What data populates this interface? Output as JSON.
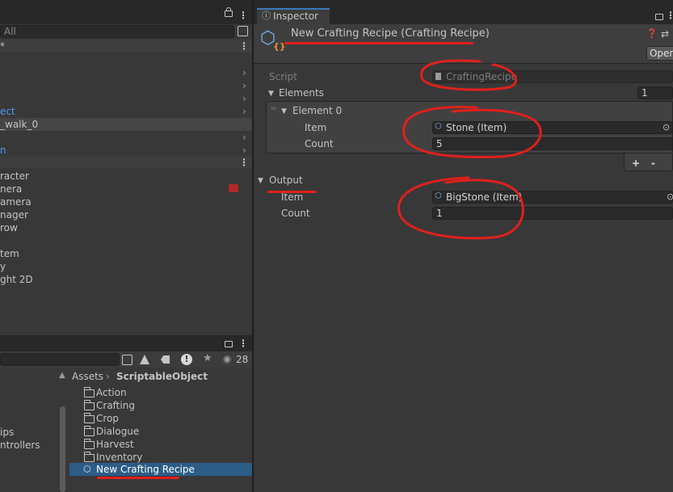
{
  "hierarchy": {
    "search_placeholder": "All",
    "scene_marker": "*",
    "items": [
      "ect",
      "_walk_0",
      "n"
    ],
    "items2": [
      "racter",
      "nera",
      "amera",
      "nager",
      "row",
      "tem",
      "y",
      "ght 2D"
    ]
  },
  "project": {
    "count": "28",
    "left_items": [
      "ips",
      "ntrollers"
    ],
    "breadcrumb": [
      "Assets",
      "ScriptableObject"
    ],
    "folders": [
      "Action",
      "Crafting",
      "Crop",
      "Dialogue",
      "Harvest",
      "Inventory"
    ],
    "selected_asset": "New Crafting Recipe"
  },
  "inspector": {
    "tab_label": "Inspector",
    "title": "New Crafting Recipe (Crafting Recipe)",
    "open_button": "Open",
    "script_label": "Script",
    "script_value": "CraftingRecipe",
    "elements_label": "Elements",
    "elements_count": "1",
    "element0_label": "Element 0",
    "item_label": "Item",
    "item_value": "Stone (Item)",
    "count_label": "Count",
    "count_value": "5",
    "output_label": "Output",
    "output_item_value": "BigStone (Item)",
    "output_count_value": "1",
    "add_label": "+",
    "remove_label": "-"
  },
  "colors": {
    "panel_bg": "#383838",
    "tab_bg": "#282828",
    "selection": "#2c5d87",
    "accent_text": "#4d9df5",
    "annotation_red": "#e0201c"
  }
}
